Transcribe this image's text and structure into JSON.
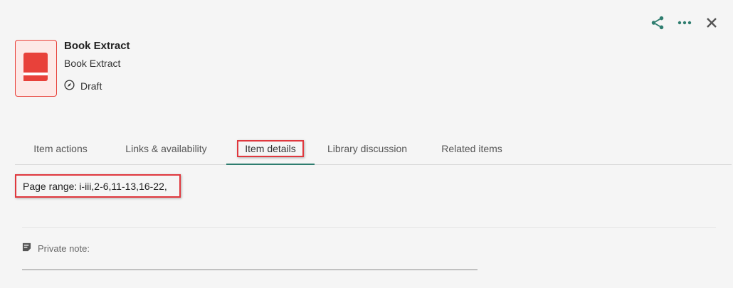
{
  "header": {
    "title": "Book Extract",
    "subtitle": "Book Extract",
    "status": "Draft"
  },
  "actions": {
    "share_icon": "share-icon",
    "more_icon": "more-horizontal-icon",
    "close_icon": "close-icon",
    "accent_color": "#2e7d6f"
  },
  "tabs": [
    {
      "label": "Item actions",
      "active": false
    },
    {
      "label": "Links & availability",
      "active": false
    },
    {
      "label": "Item details",
      "active": true
    },
    {
      "label": "Library discussion",
      "active": false
    },
    {
      "label": "Related items",
      "active": false
    }
  ],
  "details": {
    "page_range_label": "Page range:",
    "page_range_value": "i-iii,2-6,11-13,16-22,",
    "private_note_label": "Private note:"
  },
  "colors": {
    "book_icon": "#e8413a",
    "highlight_border": "#e0383e"
  }
}
